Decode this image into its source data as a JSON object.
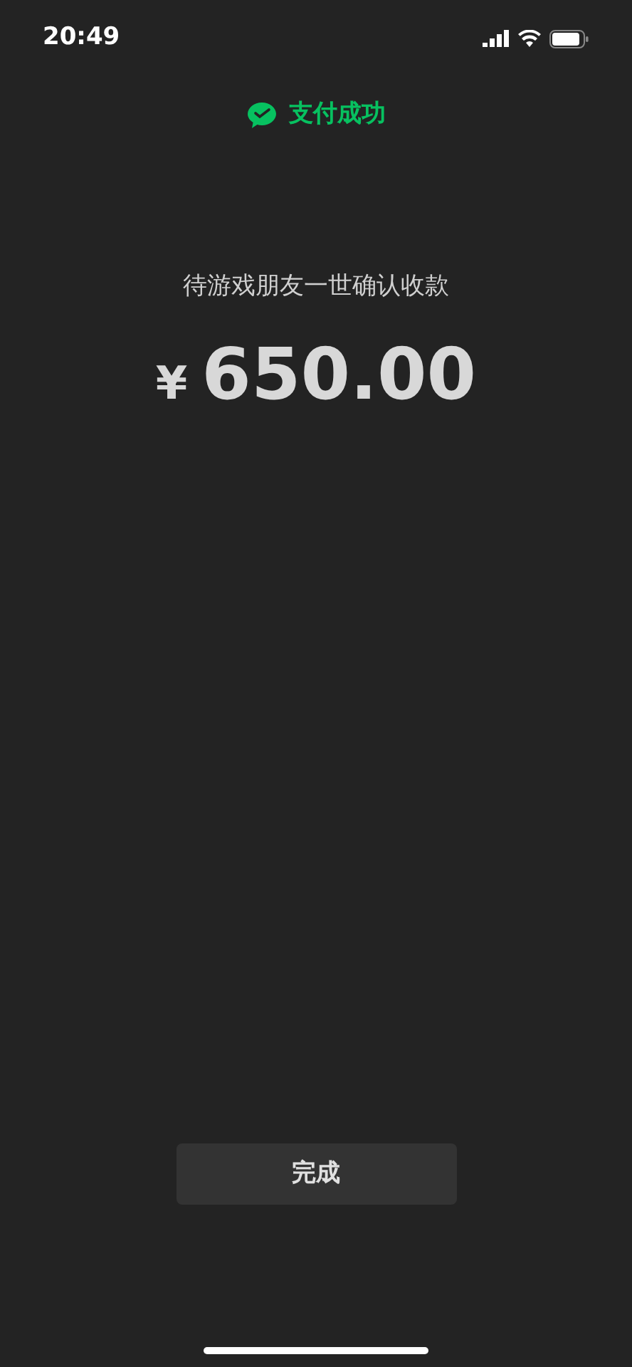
{
  "status_bar": {
    "time": "20:49"
  },
  "header": {
    "title": "支付成功"
  },
  "payment": {
    "message": "待游戏朋友一世确认收款",
    "currency": "¥",
    "amount": "650.00"
  },
  "done_button": {
    "label": "完成"
  }
}
